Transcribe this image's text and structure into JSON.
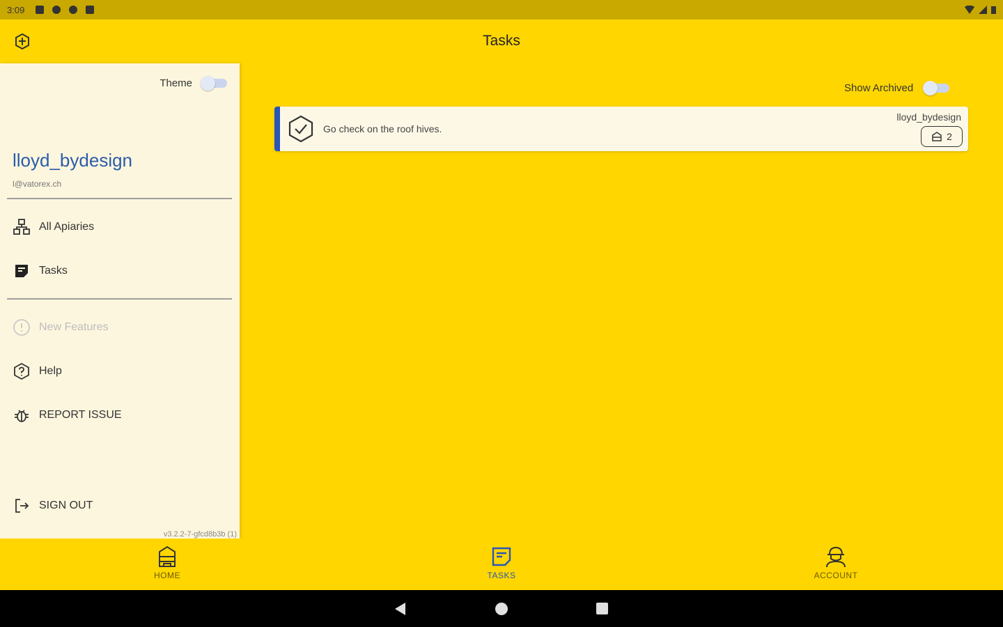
{
  "status_bar": {
    "time": "3:09"
  },
  "app_bar": {
    "title": "Tasks",
    "logo_icon": "hive-logo-icon"
  },
  "drawer": {
    "theme_label": "Theme",
    "user_name": "lloyd_bydesign",
    "user_email": "l@vatorex.ch",
    "nav_items": [
      {
        "label": "All Apiaries",
        "icon": "apiaries-icon"
      },
      {
        "label": "Tasks",
        "icon": "tasks-icon"
      }
    ],
    "secondary_items": [
      {
        "label": "New Features",
        "icon": "new-features-icon",
        "disabled": true
      },
      {
        "label": "Help",
        "icon": "help-icon"
      },
      {
        "label": "REPORT ISSUE",
        "icon": "bug-icon"
      }
    ],
    "sign_out_label": "SIGN OUT",
    "version": "v3.2.2-7-gfcd8b3b (1)"
  },
  "main": {
    "show_archived_label": "Show Archived",
    "tasks": [
      {
        "description": "Go check on the roof hives.",
        "owner": "lloyd_bydesign",
        "hive_count": "2"
      }
    ]
  },
  "bottom_nav": {
    "tabs": [
      {
        "label": "HOME",
        "icon": "home-hive-icon"
      },
      {
        "label": "TASKS",
        "icon": "tasks-icon",
        "active": true
      },
      {
        "label": "ACCOUNT",
        "icon": "beekeeper-icon"
      }
    ]
  },
  "colors": {
    "primary": "#FFD600",
    "accent": "#2A55B8",
    "drawer_bg": "#FDF6DE"
  }
}
